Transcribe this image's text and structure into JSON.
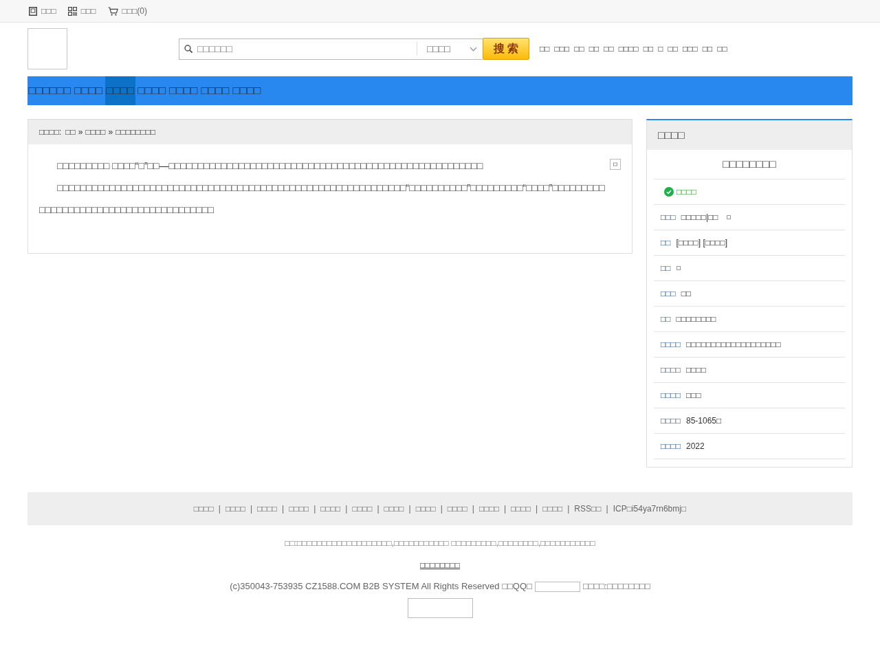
{
  "top_bar": {
    "items": [
      {
        "kind": "tablet",
        "label": "□□□"
      },
      {
        "kind": "qr",
        "label": "□□□"
      },
      {
        "kind": "cart",
        "label": "□□□(0)"
      }
    ]
  },
  "header": {
    "search": {
      "placeholder": "□□□□□□",
      "category": "□□□□",
      "button": "搜索"
    },
    "links": [
      "□□",
      "□□□",
      "□□",
      "□□",
      "□□",
      "□□□□",
      "□□",
      "□",
      "□□",
      "□□□",
      "□□",
      "□□"
    ]
  },
  "nav": {
    "items": [
      {
        "label": "□□□□□□",
        "selected": false
      },
      {
        "label": "□□□□",
        "selected": false
      },
      {
        "label": "□□□□",
        "selected": true
      },
      {
        "label": "□□□□",
        "selected": false
      },
      {
        "label": "□□□□",
        "selected": false
      },
      {
        "label": "□□□□",
        "selected": false
      },
      {
        "label": "□□□□",
        "selected": false
      }
    ]
  },
  "article": {
    "breadcrumb": {
      "label": "□□□□:",
      "items": [
        {
          "text": "□□"
        },
        {
          "separator": "»",
          "text": "□□□□"
        },
        {
          "separator": "»",
          "text": "□□□□□□□□"
        }
      ]
    },
    "paragraphs": [
      "□□□□□□□□□ □□□□“□”□□—□□□□□□□□□□□□□□□□□□□□□□□□□□□□□□□□□□□□□□□□□□□□□□□□□□□□□□",
      "□□□□□□□□□□□□□□□□□□□□□□□□□□□□□□□□□□□□□□□□□□□□□□□□□□□□□□□□□□□□“□□□□□□□□□□”□□□□□□□□□“□□□□”□□□□□□□□□□□□□□□□□□□□□□□□□□□□□□□□□□□□□□□"
    ]
  },
  "sidebar": {
    "title": "□□□□",
    "company": "□□□□□□□□",
    "verified": "□□□□",
    "fields": [
      {
        "kind": "text_image",
        "key": "□□□",
        "value": "□□□□□|□□"
      },
      {
        "kind": "text",
        "key": "□□",
        "value": "[□□□□] [□□□□]"
      },
      {
        "kind": "image",
        "key": "□□"
      },
      {
        "kind": "text",
        "key": "□□□",
        "value": "□□"
      },
      {
        "kind": "text",
        "key": "□□",
        "value": "□□□□□□□□"
      },
      {
        "kind": "text",
        "key": "□□□□",
        "value": "□□□□□□□□□□□□□□□□□□□"
      },
      {
        "kind": "text",
        "key": "□□□□",
        "value": "□□□□"
      },
      {
        "kind": "text",
        "key": "□□□□",
        "value": "□□□"
      },
      {
        "kind": "text",
        "key": "□□□□",
        "value": "85-1065□"
      },
      {
        "kind": "text",
        "key": "□□□□",
        "value": "2022"
      }
    ]
  },
  "footer": {
    "links": [
      {
        "label": "□□□□",
        "separator": "|"
      },
      {
        "label": "□□□□",
        "separator": "|"
      },
      {
        "label": "□□□□",
        "separator": "|"
      },
      {
        "label": "□□□□",
        "separator": "|"
      },
      {
        "label": "□□□□",
        "separator": "|"
      },
      {
        "label": "□□□□",
        "separator": "|"
      },
      {
        "label": "□□□□",
        "separator": "|"
      },
      {
        "label": "□□□□",
        "separator": "|"
      },
      {
        "label": "□□□□",
        "separator": "|"
      },
      {
        "label": "□□□□",
        "separator": "|"
      },
      {
        "label": "□□□□",
        "separator": "|"
      },
      {
        "label": "□□□□",
        "separator": "|"
      },
      {
        "label": "RSS□□",
        "separator": "|"
      },
      {
        "label": "ICP□i54ya7rn6bmj□"
      }
    ],
    "notice": "□□:□□□□□□□□□□□□□□□□□□□,□□□□□□□□□□□ □□□□□□□□□,□□□□□□□□,□□□□□□□□□□□",
    "link": "□□□□□□□□",
    "copyright": "(c)350043-753935 CZ1588.COM B2B SYSTEM All Rights Reserved □□QQ□",
    "contact": "□□□□:□□□□□□□□"
  }
}
